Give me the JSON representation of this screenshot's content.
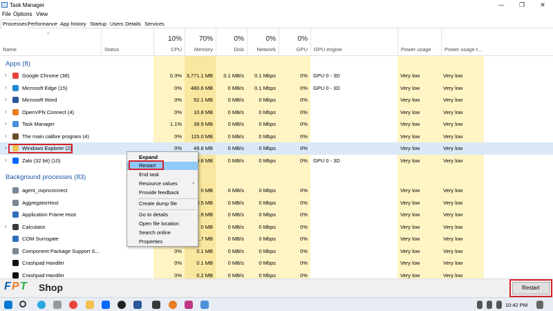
{
  "window": {
    "title": "Task Manager",
    "minimize_glyph": "—",
    "maximize_glyph": "❐",
    "close_glyph": "✕"
  },
  "menu": {
    "file": "File",
    "options": "Options",
    "view": "View"
  },
  "tabs": [
    "Processes",
    "Performance",
    "App history",
    "Startup",
    "Users",
    "Details",
    "Services"
  ],
  "columns": {
    "name": "Name",
    "status": "Status",
    "cpu": {
      "pct": "10%",
      "label": "CPU"
    },
    "memory": {
      "pct": "70%",
      "label": "Memory"
    },
    "disk": {
      "pct": "0%",
      "label": "Disk"
    },
    "network": {
      "pct": "0%",
      "label": "Network"
    },
    "gpu": {
      "pct": "0%",
      "label": "GPU"
    },
    "gpu_engine": "GPU engine",
    "power": "Power usage",
    "power_trend": "Power usage t..."
  },
  "groups": {
    "apps": "Apps (8)",
    "background": "Background processes (83)"
  },
  "apps": [
    {
      "name": "Google Chrome (38)",
      "cpu": "0.3%",
      "mem": "3,771.1 MB",
      "disk": "0.1 MB/s",
      "net": "0.1 Mbps",
      "gpu": "0%",
      "engine": "GPU 0 - 3D",
      "power": "Very low",
      "trend": "Very low",
      "icon": "chrome-icon",
      "color": "#e8453c"
    },
    {
      "name": "Microsoft Edge (15)",
      "cpu": "0%",
      "mem": "480.6 MB",
      "disk": "0 MB/s",
      "net": "0.1 Mbps",
      "gpu": "0%",
      "engine": "GPU 0 - 3D",
      "power": "Very low",
      "trend": "Very low",
      "icon": "edge-icon",
      "color": "#1f8bd3"
    },
    {
      "name": "Microsoft Word",
      "cpu": "0%",
      "mem": "52.1 MB",
      "disk": "0 MB/s",
      "net": "0 Mbps",
      "gpu": "0%",
      "engine": "",
      "power": "Very low",
      "trend": "Very low",
      "icon": "word-icon",
      "color": "#2b579a"
    },
    {
      "name": "OpenVPN Connect (4)",
      "cpu": "0%",
      "mem": "10.8 MB",
      "disk": "0 MB/s",
      "net": "0 Mbps",
      "gpu": "0%",
      "engine": "",
      "power": "Very low",
      "trend": "Very low",
      "icon": "openvpn-icon",
      "color": "#ea7e20"
    },
    {
      "name": "Task Manager",
      "cpu": "1.1%",
      "mem": "39.9 MB",
      "disk": "0 MB/s",
      "net": "0 Mbps",
      "gpu": "0%",
      "engine": "",
      "power": "Very low",
      "trend": "Very low",
      "icon": "task-manager-icon",
      "color": "#4a90d9"
    },
    {
      "name": "The main calibre program (4)",
      "cpu": "0%",
      "mem": "115.0 MB",
      "disk": "0 MB/s",
      "net": "0 Mbps",
      "gpu": "0%",
      "engine": "",
      "power": "Very low",
      "trend": "Very low",
      "icon": "calibre-icon",
      "color": "#6b4f2a"
    },
    {
      "name": "Windows Explorer (2)",
      "cpu": "0%",
      "mem": "49.8 MB",
      "disk": "0 MB/s",
      "net": "0 Mbps",
      "gpu": "0%",
      "engine": "",
      "power": "Very low",
      "trend": "Very low",
      "icon": "folder-icon",
      "color": "#f2c14e"
    },
    {
      "name": "Zalo (32 bit) (10)",
      "cpu": "0%",
      "mem": "79.8 MB",
      "disk": "0 MB/s",
      "net": "0 Mbps",
      "gpu": "0%",
      "engine": "GPU 0 - 3D",
      "power": "Very low",
      "trend": "Very low",
      "icon": "zalo-icon",
      "color": "#0068ff"
    }
  ],
  "background": [
    {
      "name": "agent_ovpnconnect",
      "exp": false,
      "cpu": "0%",
      "mem": "0 MB",
      "disk": "0 MB/s",
      "net": "0 Mbps",
      "gpu": "0%",
      "power": "Very low",
      "trend": "Very low",
      "icon": "app-icon",
      "color": "#7a8896"
    },
    {
      "name": "AggregatorHost",
      "exp": false,
      "cpu": "0%",
      "mem": "0.5 MB",
      "disk": "0 MB/s",
      "net": "0 Mbps",
      "gpu": "0%",
      "power": "Very low",
      "trend": "Very low",
      "icon": "app-icon",
      "color": "#7a8896"
    },
    {
      "name": "Application Frame Host",
      "exp": false,
      "cpu": "0%",
      "mem": "1.9 MB",
      "disk": "0 MB/s",
      "net": "0 Mbps",
      "gpu": "0%",
      "power": "Very low",
      "trend": "Very low",
      "icon": "app-icon",
      "color": "#2f6fbf"
    },
    {
      "name": "Calculator",
      "exp": true,
      "cpu": "0%",
      "mem": "0 MB",
      "disk": "0 MB/s",
      "net": "0 Mbps",
      "gpu": "0%",
      "power": "Very low",
      "trend": "Very low",
      "icon": "calculator-icon",
      "color": "#3a3a3a"
    },
    {
      "name": "COM Surrogate",
      "exp": false,
      "cpu": "0%",
      "mem": "1.7 MB",
      "disk": "0 MB/s",
      "net": "0 Mbps",
      "gpu": "0%",
      "power": "Very low",
      "trend": "Very low",
      "icon": "app-icon",
      "color": "#2f6fbf"
    },
    {
      "name": "Component Package Support S...",
      "exp": false,
      "cpu": "0%",
      "mem": "0.1 MB",
      "disk": "0 MB/s",
      "net": "0 Mbps",
      "gpu": "0%",
      "power": "Very low",
      "trend": "Very low",
      "icon": "app-icon",
      "color": "#7a8896"
    },
    {
      "name": "Crashpad Handler",
      "exp": false,
      "cpu": "0%",
      "mem": "0.1 MB",
      "disk": "0 MB/s",
      "net": "0 Mbps",
      "gpu": "0%",
      "power": "Very low",
      "trend": "Very low",
      "icon": "crashpad-icon",
      "color": "#111111"
    },
    {
      "name": "Crashpad Handler",
      "exp": false,
      "cpu": "0%",
      "mem": "0.2 MB",
      "disk": "0 MB/s",
      "net": "0 Mbps",
      "gpu": "0%",
      "power": "Very low",
      "trend": "Very low",
      "icon": "crashpad-icon",
      "color": "#111111"
    }
  ],
  "context_menu": [
    "Expand",
    "Restart",
    "End task",
    "Resource values",
    "Provide feedback",
    "Create dump file",
    "Go to details",
    "Open file location",
    "Search online",
    "Properties"
  ],
  "restart_button": "Restart",
  "brand": {
    "fpt": "FPT",
    "shop": "Shop"
  },
  "clock": "10:42 PM",
  "accent": "#d3232a"
}
